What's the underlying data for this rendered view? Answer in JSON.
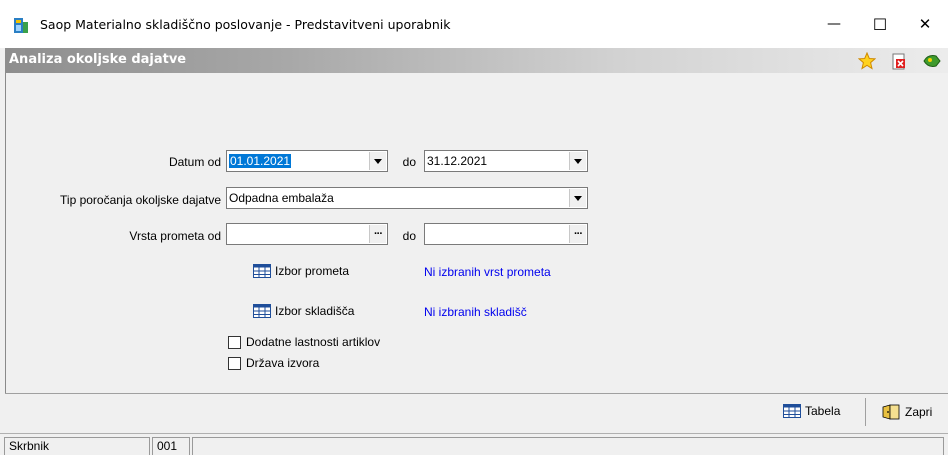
{
  "window": {
    "title": "Saop Materialno skladiščno poslovanje - Predstavitveni uporabnik",
    "minimize_glyph": "—",
    "maximize_glyph": "☐",
    "close_glyph": "✕"
  },
  "header": {
    "title": "Analiza okoljske dajatve",
    "icons": [
      "star-icon",
      "delete-doc-icon",
      "exit-icon"
    ]
  },
  "form": {
    "date_from_label": "Datum od",
    "date_from_value": "01.01.2021",
    "date_to_label": "do",
    "date_to_value": "31.12.2021",
    "report_type_label": "Tip poročanja okoljske dajatve",
    "report_type_value": "Odpadna embalaža",
    "traffic_from_label": "Vrsta prometa od",
    "traffic_from_value": "",
    "traffic_to_label": "do",
    "traffic_to_value": "",
    "lookup_glyph": "···",
    "select_traffic_label": "Izbor prometa",
    "select_traffic_info": "Ni izbranih vrst prometa",
    "select_warehouse_label": "Izbor skladišča",
    "select_warehouse_info": "Ni izbranih skladišč",
    "checkbox_extra_props": "Dodatne lastnosti artiklov",
    "checkbox_extra_props_checked": false,
    "checkbox_country": "Država izvora",
    "checkbox_country_checked": false
  },
  "toolbar": {
    "table_label": "Tabela",
    "close_label": "Zapri"
  },
  "status": {
    "user": "Skrbnik",
    "code": "001"
  },
  "colors": {
    "link": "#0000ee",
    "selection": "#0078d7"
  }
}
